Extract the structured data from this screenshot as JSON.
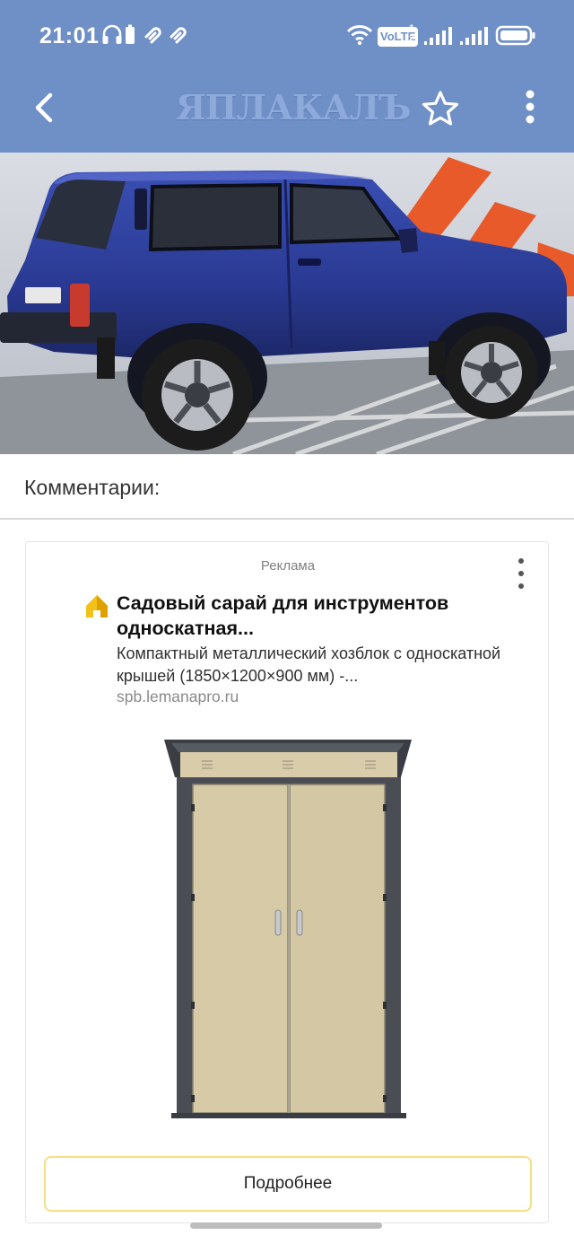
{
  "status_bar": {
    "time": "21:01",
    "volte": "VoLTE",
    "volte_sim": "1",
    "volte_sim2": "2",
    "icons": [
      "headphones-icon",
      "battery-saver-icon",
      "link-icon",
      "link-icon",
      "wifi-icon",
      "signal-icon",
      "signal-icon",
      "battery-icon"
    ]
  },
  "header": {
    "logo": "ЯПЛАКАЛЪ",
    "icons": [
      "back-arrow-icon",
      "star-icon",
      "more-vert-icon"
    ]
  },
  "hero": {
    "icon": "car-photo"
  },
  "comments": {
    "title": "Комментарии:"
  },
  "ad": {
    "label": "Реклама",
    "title": "Садовый сарай для инструментов односкатная...",
    "description": "Компактный металлический хозблок с односкатной крышей (1850×1200×900 мм) -...",
    "domain": "spb.lemanapro.ru",
    "button": "Подробнее",
    "icons": [
      "more-vert-icon",
      "house-logo-icon",
      "shed-photo"
    ]
  },
  "colors": {
    "header_bg": "#6f8fc7",
    "button_border": "#f3df86",
    "car_blue": "#2c3d97"
  }
}
